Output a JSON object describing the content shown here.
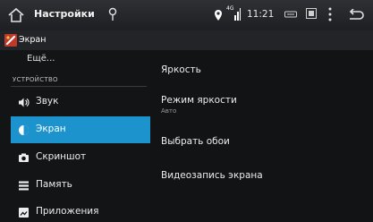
{
  "status_bar": {
    "title": "Настройки",
    "signal_label": "4G",
    "time": "11:21",
    "icons": [
      "home-icon",
      "location-pin-icon",
      "signal-icon",
      "dvd-icon",
      "screen-icon",
      "overflow-menu-icon",
      "back-icon"
    ]
  },
  "header": {
    "title": "Экран",
    "icon": "display-settings-icon"
  },
  "sidebar": {
    "more_label": "Ещё...",
    "section_label": "УСТРОЙСТВО",
    "items": [
      {
        "label": "Звук",
        "icon": "sound-icon"
      },
      {
        "label": "Экран",
        "icon": "display-icon",
        "selected": true
      },
      {
        "label": "Скриншот",
        "icon": "camera-icon"
      },
      {
        "label": "Память",
        "icon": "storage-icon"
      },
      {
        "label": "Приложения",
        "icon": "apps-icon"
      }
    ]
  },
  "detail": {
    "items": [
      {
        "title": "Яркость",
        "summary": ""
      },
      {
        "title": "Режим яркости",
        "summary": "Авто"
      },
      {
        "title": "Выбрать обои",
        "summary": ""
      },
      {
        "title": "Видеозапись экрана",
        "summary": ""
      }
    ]
  },
  "colors": {
    "accent": "#1c93cc",
    "background": "#121315",
    "status_bar": "#2a2b2e"
  }
}
